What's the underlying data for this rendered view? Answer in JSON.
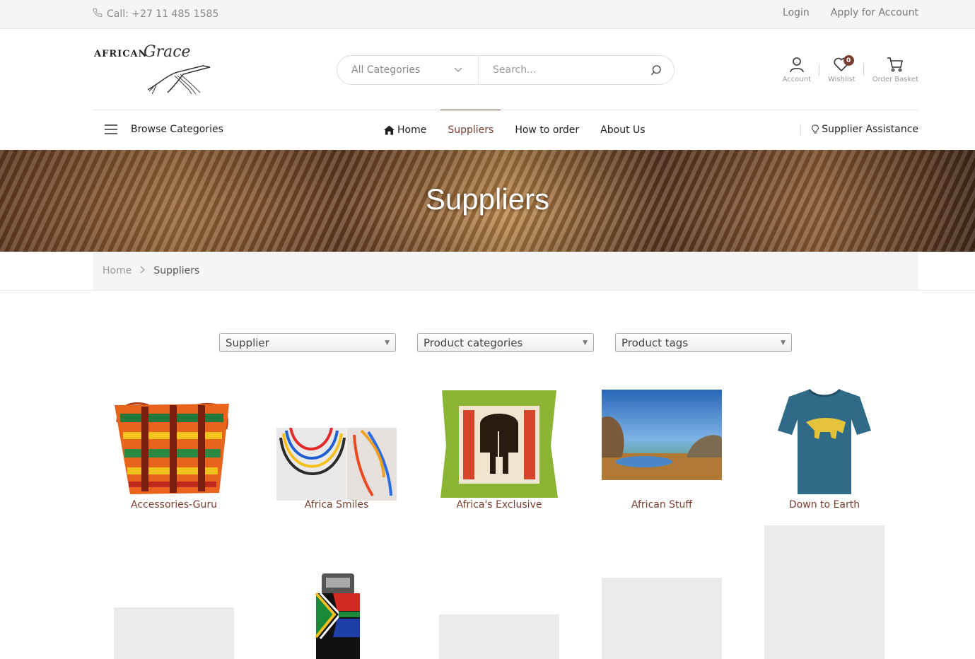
{
  "topbar": {
    "phone": "Call: +27 11 485 1585",
    "login": "Login",
    "apply": "Apply for Account"
  },
  "logo": {
    "brand": "AFRICAN",
    "script": "Grace"
  },
  "search": {
    "category": "All Categories",
    "placeholder": "Search..."
  },
  "header_icons": {
    "account": "Account",
    "wishlist": "Wishlist",
    "wishlist_count": "0",
    "basket": "Order Basket"
  },
  "nav": {
    "browse": "Browse Categories",
    "items": [
      {
        "label": "Home",
        "active": false
      },
      {
        "label": "Suppliers",
        "active": true
      },
      {
        "label": "How to order",
        "active": false
      },
      {
        "label": "About Us",
        "active": false
      }
    ],
    "assistance": "Supplier Assistance"
  },
  "hero": {
    "title": "Suppliers"
  },
  "breadcrumb": {
    "home": "Home",
    "current": "Suppliers"
  },
  "filters": {
    "supplier": "Supplier",
    "categories": "Product categories",
    "tags": "Product tags"
  },
  "suppliers": [
    {
      "name": "Accessories-Guru",
      "image": "bag-icon"
    },
    {
      "name": "Africa Smiles",
      "image": "necklace-icon"
    },
    {
      "name": "Africa's Exclusive",
      "image": "cushion-icon"
    },
    {
      "name": "African Stuff",
      "image": "book-cover-icon"
    },
    {
      "name": "Down to Earth",
      "image": "tshirt-icon"
    }
  ],
  "colors": {
    "accent": "#7a3e2e",
    "topbar_bg": "#f5f5f5",
    "placeholder": "#ebebeb"
  }
}
